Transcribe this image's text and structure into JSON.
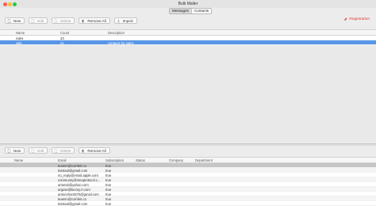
{
  "window": {
    "title": "Bulk Mailer"
  },
  "tabs": [
    {
      "label": "Messages",
      "active": true
    },
    {
      "label": "Contacts",
      "active": false
    }
  ],
  "top_toolbar": {
    "new": "New",
    "edit": "Edit",
    "delete": "Delete",
    "remove_all": "Remove All",
    "import": "Import",
    "registration": "Registration"
  },
  "groups": {
    "columns": [
      "Name",
      "Count",
      "Description"
    ],
    "rows": [
      {
        "name": "rates",
        "count": "23",
        "description": ""
      },
      {
        "name": "sale",
        "count": "21",
        "description": "contacts for sales",
        "selected": true
      }
    ]
  },
  "bottom_toolbar": {
    "new": "New",
    "edit": "Edit",
    "delete": "Delete",
    "remove_all": "Remove All"
  },
  "contacts": {
    "columns": [
      "Name",
      "Email",
      "Subscription",
      "Status",
      "Company",
      "Department"
    ],
    "rows": [
      {
        "name": "",
        "email": "teamm@coinfeit.co",
        "subscription": "true"
      },
      {
        "name": "",
        "email": "tivistaol@gmail.com",
        "subscription": "true"
      },
      {
        "name": "",
        "email": "no_reply@email.apple.com",
        "subscription": "true"
      },
      {
        "name": "",
        "email": "communty@mnaprotocol.c...",
        "subscription": "true"
      },
      {
        "name": "",
        "email": "ament2@yahoo.com",
        "subscription": "true"
      },
      {
        "name": "",
        "email": "argose@becny.rr.com",
        "subscription": "true"
      },
      {
        "name": "",
        "email": "aronechantS75@gmail.com",
        "subscription": "true"
      },
      {
        "name": "",
        "email": "teamm@coinfeit.co",
        "subscription": "true"
      },
      {
        "name": "",
        "email": "tivistaol@gmail.com",
        "subscription": "true"
      }
    ]
  },
  "colors": {
    "selection": "#5796e8",
    "registration": "#e0382c"
  }
}
